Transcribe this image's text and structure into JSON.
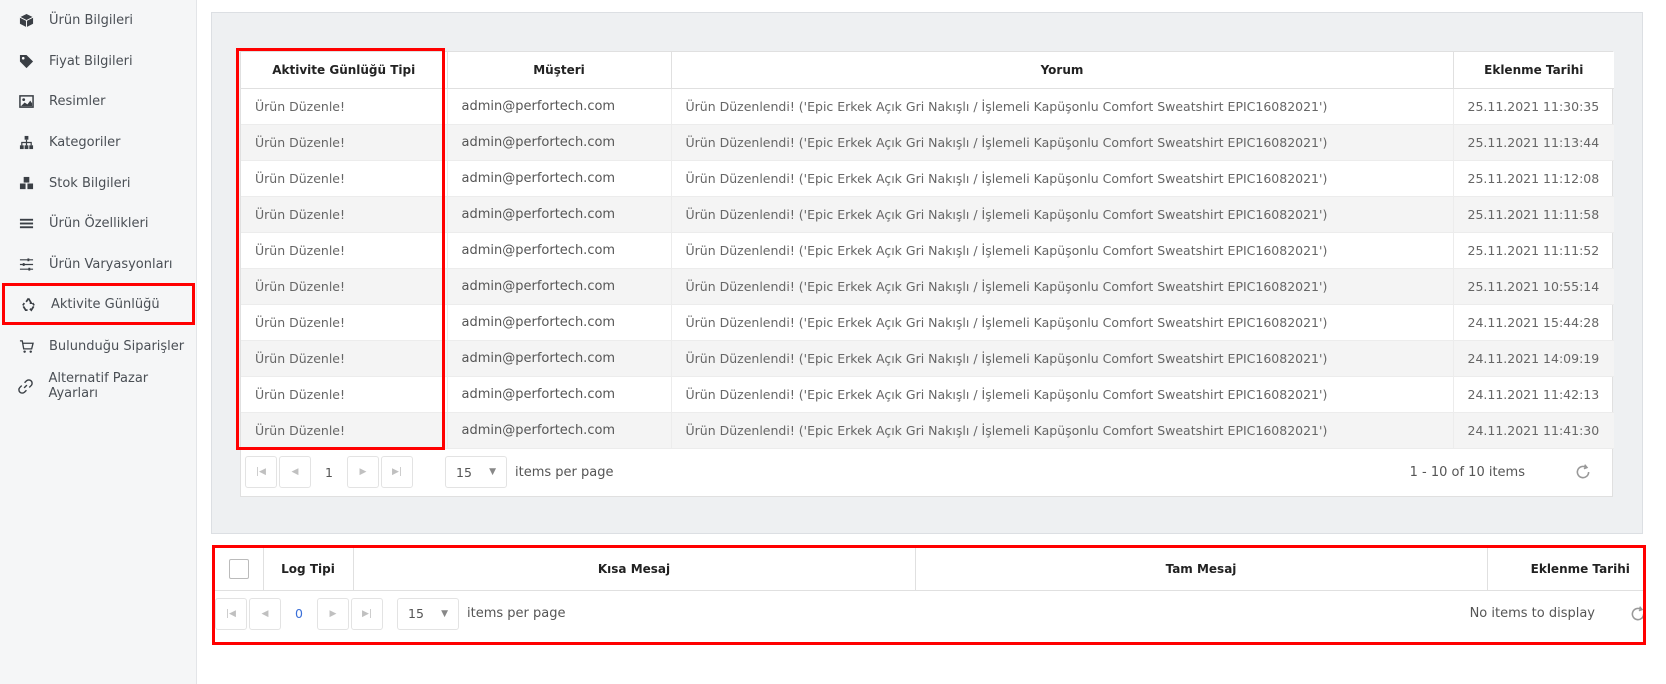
{
  "sidebar": {
    "items": [
      {
        "label": "Ürün Bilgileri",
        "icon": "box-icon"
      },
      {
        "label": "Fiyat Bilgileri",
        "icon": "tag-icon"
      },
      {
        "label": "Resimler",
        "icon": "image-icon"
      },
      {
        "label": "Kategoriler",
        "icon": "sitemap-icon"
      },
      {
        "label": "Stok Bilgileri",
        "icon": "cubes-icon"
      },
      {
        "label": "Ürün Özellikleri",
        "icon": "list-icon"
      },
      {
        "label": "Ürün Varyasyonları",
        "icon": "sliders-icon"
      },
      {
        "label": "Aktivite Günlüğü",
        "icon": "recycle-icon"
      },
      {
        "label": "Bulunduğu Siparişler",
        "icon": "cart-icon"
      },
      {
        "label": "Alternatif Pazar Ayarları",
        "icon": "link-icon"
      }
    ]
  },
  "activity": {
    "columns": [
      "Aktivite Günlüğü Tipi",
      "Müşteri",
      "Yorum",
      "Eklenme Tarihi"
    ],
    "rows": [
      {
        "type": "Ürün Düzenle!",
        "customer": "admin@perfortech.com",
        "comment": "Ürün Düzenlendi! ('Epic Erkek Açık Gri Nakışlı / İşlemeli Kapüşonlu Comfort Sweatshirt EPIC16082021')",
        "date": "25.11.2021 11:30:35"
      },
      {
        "type": "Ürün Düzenle!",
        "customer": "admin@perfortech.com",
        "comment": "Ürün Düzenlendi! ('Epic Erkek Açık Gri Nakışlı / İşlemeli Kapüşonlu Comfort Sweatshirt EPIC16082021')",
        "date": "25.11.2021 11:13:44"
      },
      {
        "type": "Ürün Düzenle!",
        "customer": "admin@perfortech.com",
        "comment": "Ürün Düzenlendi! ('Epic Erkek Açık Gri Nakışlı / İşlemeli Kapüşonlu Comfort Sweatshirt EPIC16082021')",
        "date": "25.11.2021 11:12:08"
      },
      {
        "type": "Ürün Düzenle!",
        "customer": "admin@perfortech.com",
        "comment": "Ürün Düzenlendi! ('Epic Erkek Açık Gri Nakışlı / İşlemeli Kapüşonlu Comfort Sweatshirt EPIC16082021')",
        "date": "25.11.2021 11:11:58"
      },
      {
        "type": "Ürün Düzenle!",
        "customer": "admin@perfortech.com",
        "comment": "Ürün Düzenlendi! ('Epic Erkek Açık Gri Nakışlı / İşlemeli Kapüşonlu Comfort Sweatshirt EPIC16082021')",
        "date": "25.11.2021 11:11:52"
      },
      {
        "type": "Ürün Düzenle!",
        "customer": "admin@perfortech.com",
        "comment": "Ürün Düzenlendi! ('Epic Erkek Açık Gri Nakışlı / İşlemeli Kapüşonlu Comfort Sweatshirt EPIC16082021')",
        "date": "25.11.2021 10:55:14"
      },
      {
        "type": "Ürün Düzenle!",
        "customer": "admin@perfortech.com",
        "comment": "Ürün Düzenlendi! ('Epic Erkek Açık Gri Nakışlı / İşlemeli Kapüşonlu Comfort Sweatshirt EPIC16082021')",
        "date": "24.11.2021 15:44:28"
      },
      {
        "type": "Ürün Düzenle!",
        "customer": "admin@perfortech.com",
        "comment": "Ürün Düzenlendi! ('Epic Erkek Açık Gri Nakışlı / İşlemeli Kapüşonlu Comfort Sweatshirt EPIC16082021')",
        "date": "24.11.2021 14:09:19"
      },
      {
        "type": "Ürün Düzenle!",
        "customer": "admin@perfortech.com",
        "comment": "Ürün Düzenlendi! ('Epic Erkek Açık Gri Nakışlı / İşlemeli Kapüşonlu Comfort Sweatshirt EPIC16082021')",
        "date": "24.11.2021 11:42:13"
      },
      {
        "type": "Ürün Düzenle!",
        "customer": "admin@perfortech.com",
        "comment": "Ürün Düzenlendi! ('Epic Erkek Açık Gri Nakışlı / İşlemeli Kapüşonlu Comfort Sweatshirt EPIC16082021')",
        "date": "24.11.2021 11:41:30"
      }
    ],
    "pager": {
      "page": "1",
      "page_size": "15",
      "per_page_label": "items per page",
      "info": "1 - 10 of 10 items"
    }
  },
  "log": {
    "columns": [
      "Log Tipi",
      "Kısa Mesaj",
      "Tam Mesaj",
      "Eklenme Tarihi"
    ],
    "pager": {
      "page": "0",
      "page_size": "15",
      "per_page_label": "items per page",
      "info": "No items to display"
    }
  },
  "colors": {
    "highlight": "#ff0000",
    "link": "#3a6fd8"
  }
}
